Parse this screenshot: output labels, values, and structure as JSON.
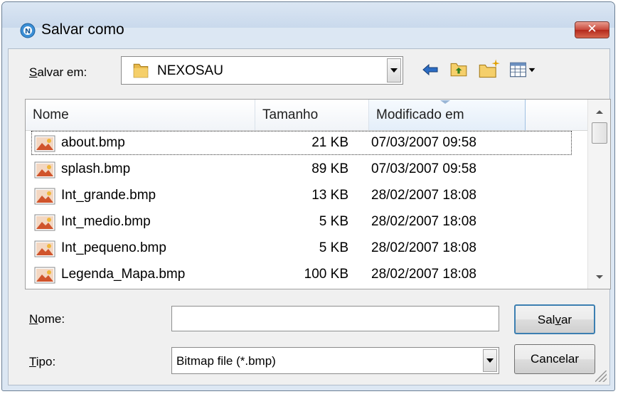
{
  "window": {
    "title": "Salvar como",
    "close_label": "✕",
    "app_icon_glyph": "N"
  },
  "toolbar": {
    "save_in_label_prefix": "S",
    "save_in_label_rest": "alvar em:",
    "save_in_value": "NEXOSAU",
    "icons": [
      "back-arrow-icon",
      "up-folder-icon",
      "new-folder-icon",
      "view-menu-icon"
    ]
  },
  "file_list": {
    "columns": [
      "Nome",
      "Tamanho",
      "Modificado em"
    ],
    "rows": [
      {
        "name": "about.bmp",
        "size": "21 KB",
        "modified": "07/03/2007 09:58"
      },
      {
        "name": "splash.bmp",
        "size": "89 KB",
        "modified": "07/03/2007 09:58"
      },
      {
        "name": "Int_grande.bmp",
        "size": "13 KB",
        "modified": "28/02/2007 18:08"
      },
      {
        "name": "Int_medio.bmp",
        "size": "5 KB",
        "modified": "28/02/2007 18:08"
      },
      {
        "name": "Int_pequeno.bmp",
        "size": "5 KB",
        "modified": "28/02/2007 18:08"
      },
      {
        "name": "Legenda_Mapa.bmp",
        "size": "100 KB",
        "modified": "28/02/2007 18:08"
      }
    ]
  },
  "fields": {
    "name_label_prefix": "N",
    "name_label_rest": "ome:",
    "name_value": "",
    "type_label_prefix": "T",
    "type_label_rest": "ipo:",
    "type_value": "Bitmap file (*.bmp)"
  },
  "buttons": {
    "save_prefix": "Sal",
    "save_underlined": "v",
    "save_rest": "ar",
    "cancel": "Cancelar"
  },
  "colors": {
    "accent": "#4a90d9",
    "close_red": "#c8473a",
    "folder_yellow": "#e8b84a"
  }
}
